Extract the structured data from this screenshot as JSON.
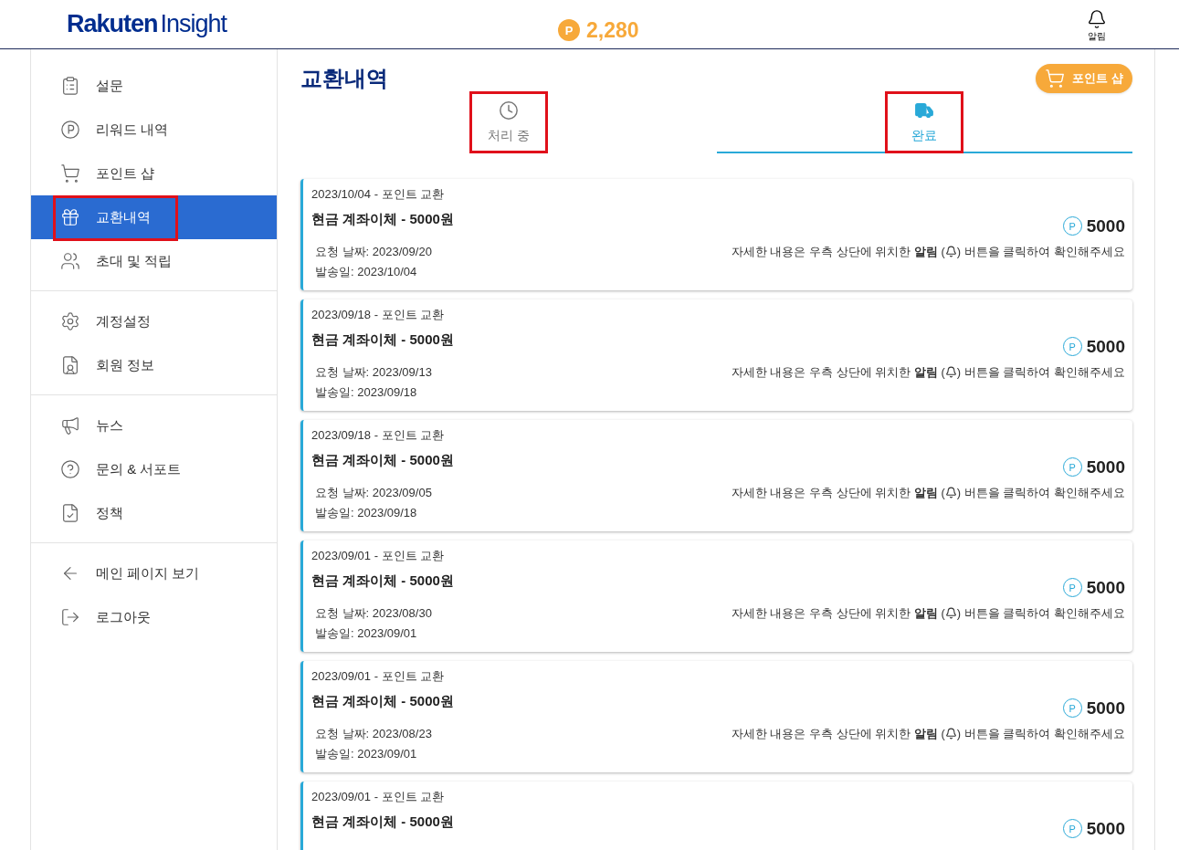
{
  "header": {
    "logo": {
      "brand": "Rakuten",
      "product": "Insight"
    },
    "points": {
      "mark": "P",
      "value": "2,280"
    },
    "notification": {
      "label": "알림"
    }
  },
  "sidebar": {
    "groups": [
      {
        "items": [
          {
            "label": "설문",
            "selected": false,
            "highlighted": false
          },
          {
            "label": "리워드 내역",
            "selected": false,
            "highlighted": false
          },
          {
            "label": "포인트 샵",
            "selected": false,
            "highlighted": false
          },
          {
            "label": "교환내역",
            "selected": true,
            "highlighted": true
          },
          {
            "label": "초대 및 적립",
            "selected": false,
            "highlighted": false
          }
        ]
      },
      {
        "items": [
          {
            "label": "계정설정",
            "selected": false,
            "highlighted": false
          },
          {
            "label": "회원 정보",
            "selected": false,
            "highlighted": false
          }
        ]
      },
      {
        "items": [
          {
            "label": "뉴스",
            "selected": false,
            "highlighted": false
          },
          {
            "label": "문의 & 서포트",
            "selected": false,
            "highlighted": false
          },
          {
            "label": "정책",
            "selected": false,
            "highlighted": false
          }
        ]
      },
      {
        "items": [
          {
            "label": "메인 페이지 보기",
            "selected": false,
            "highlighted": false
          },
          {
            "label": "로그아웃",
            "selected": false,
            "highlighted": false
          }
        ]
      }
    ]
  },
  "page": {
    "title": "교환내역",
    "shop_button": "포인트 샵",
    "tabs": [
      {
        "label": "처리 중",
        "selected": false,
        "highlighted": true
      },
      {
        "label": "완료",
        "selected": true,
        "highlighted": true
      }
    ],
    "records": [
      {
        "date_line": "2023/10/04 - 포인트 교환",
        "title": "현금 계좌이체 - 5000원",
        "mark": "P",
        "points": "5000",
        "requested": "요청 날짜: 2023/09/20",
        "sent": "발송일: 2023/10/04",
        "note_before": "자세한 내용은 우측 상단에 위치한 **알림** (",
        "note_after": ") 버튼을 클릭하여 확인해주세요"
      },
      {
        "date_line": "2023/09/18 - 포인트 교환",
        "title": "현금 계좌이체 - 5000원",
        "mark": "P",
        "points": "5000",
        "requested": "요청 날짜: 2023/09/13",
        "sent": "발송일: 2023/09/18",
        "note_before": "자세한 내용은 우측 상단에 위치한 **알림** (",
        "note_after": ") 버튼을 클릭하여 확인해주세요"
      },
      {
        "date_line": "2023/09/18 - 포인트 교환",
        "title": "현금 계좌이체 - 5000원",
        "mark": "P",
        "points": "5000",
        "requested": "요청 날짜: 2023/09/05",
        "sent": "발송일: 2023/09/18",
        "note_before": "자세한 내용은 우측 상단에 위치한 **알림** (",
        "note_after": ") 버튼을 클릭하여 확인해주세요"
      },
      {
        "date_line": "2023/09/01 - 포인트 교환",
        "title": "현금 계좌이체 - 5000원",
        "mark": "P",
        "points": "5000",
        "requested": "요청 날짜: 2023/08/30",
        "sent": "발송일: 2023/09/01",
        "note_before": "자세한 내용은 우측 상단에 위치한 **알림** (",
        "note_after": ") 버튼을 클릭하여 확인해주세요"
      },
      {
        "date_line": "2023/09/01 - 포인트 교환",
        "title": "현금 계좌이체 - 5000원",
        "mark": "P",
        "points": "5000",
        "requested": "요청 날짜: 2023/08/23",
        "sent": "발송일: 2023/09/01",
        "note_before": "자세한 내용은 우측 상단에 위치한 **알림** (",
        "note_after": ") 버튼을 클릭하여 확인해주세요"
      },
      {
        "date_line": "2023/09/01 - 포인트 교환",
        "title": "현금 계좌이체 - 5000원",
        "mark": "P",
        "points": "5000"
      }
    ]
  }
}
